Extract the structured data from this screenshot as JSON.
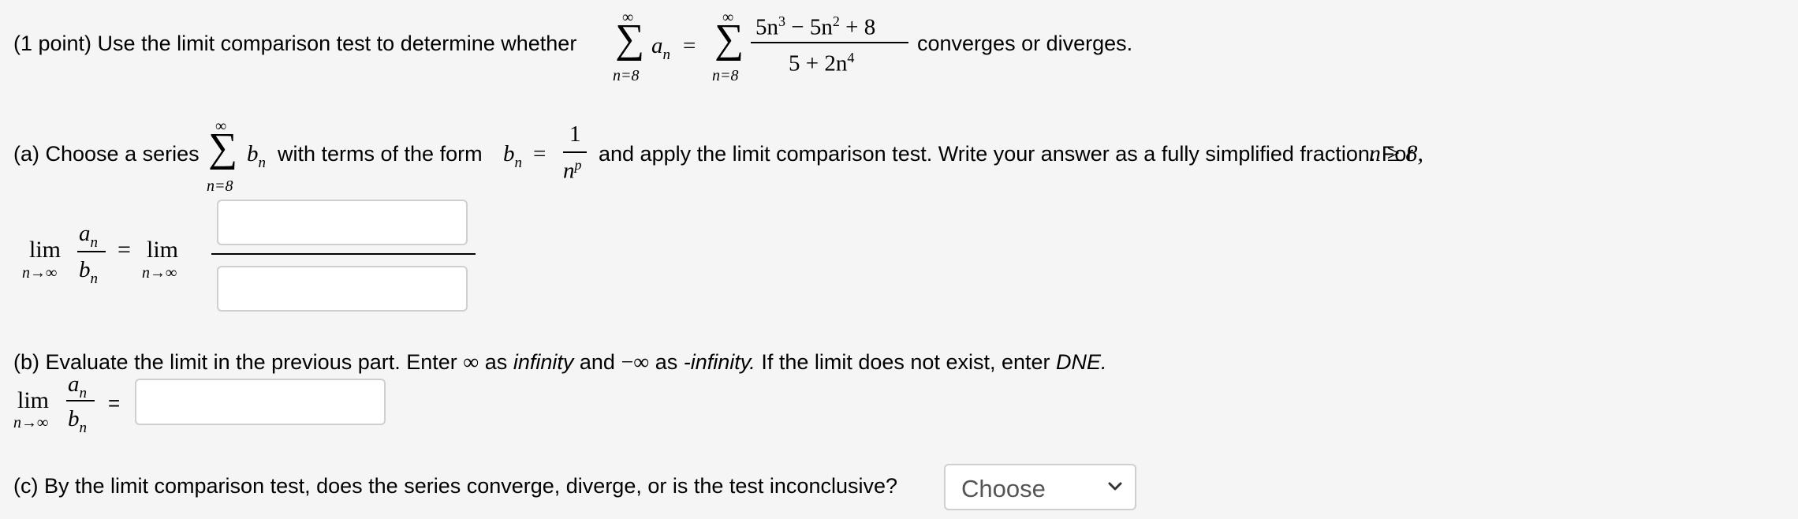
{
  "problem": {
    "intro_text": "(1 point) Use the limit comparison test to determine whether",
    "sum_symbol": "∑",
    "sum_upper": "∞",
    "sum_lower": "n=8",
    "term_a": "a",
    "term_sub": "n",
    "equals": "=",
    "numerator": {
      "c1": "5n",
      "e1": "3",
      "mid": " − 5n",
      "e2": "2",
      "end": " + 8"
    },
    "denominator": {
      "start": "5 + 2n",
      "e": "4"
    },
    "outro_text": "converges or diverges."
  },
  "part_a": {
    "lead_text": "(a) Choose a series",
    "term_b": "b",
    "mid_text": "with terms of the form",
    "bn_frac_num": "1",
    "bn_frac_den_base": "n",
    "bn_frac_den_exp": "p",
    "tail_text": "and apply the limit comparison test. Write your answer as a fully simplified fraction. For",
    "condition": "n ≥ 8,",
    "lim_word": "lim",
    "lim_sub": "n→∞",
    "ratio_num": "a",
    "ratio_den": "b",
    "numerator_input": {
      "value": "",
      "placeholder": ""
    },
    "denominator_input": {
      "value": "",
      "placeholder": ""
    }
  },
  "part_b": {
    "text_1": "(b) Evaluate the limit in the previous part. Enter",
    "inf_symbol": "∞",
    "text_2": "as",
    "infinity_word": "infinity",
    "text_3": "and",
    "neg_inf_symbol": "−∞",
    "text_4": "as",
    "neg_infinity_word": "-infinity.",
    "text_5": "If the limit does not exist, enter",
    "dne_word": "DNE.",
    "lim_word": "lim",
    "lim_sub": "n→∞",
    "ratio_num": "a",
    "ratio_den": "b",
    "equals": "=",
    "answer_input": {
      "value": "",
      "placeholder": ""
    }
  },
  "part_c": {
    "question": "(c) By the limit comparison test, does the series converge, diverge, or is the test inconclusive?",
    "select": {
      "selected": "Choose",
      "icon": "chevron-down-icon"
    }
  }
}
